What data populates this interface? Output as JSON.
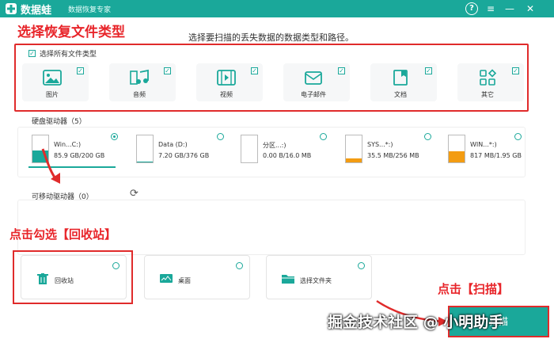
{
  "titlebar": {
    "app_name": "数据蛙",
    "app_subtitle": "数据恢复专家",
    "help_icon": "?",
    "menu_icon": "≡",
    "min_icon": "—",
    "close_icon": "✕"
  },
  "annotations": {
    "heading": "选择恢复文件类型",
    "recycle": "点击勾选【回收站】",
    "scan": "点击【扫描】"
  },
  "instruction": "选择要扫描的丢失数据的数据类型和路径。",
  "select_all": "选择所有文件类型",
  "file_types": [
    {
      "label": "图片",
      "icon": "image-icon",
      "checked": true
    },
    {
      "label": "音频",
      "icon": "audio-icon",
      "checked": true
    },
    {
      "label": "视频",
      "icon": "video-icon",
      "checked": true
    },
    {
      "label": "电子邮件",
      "icon": "email-icon",
      "checked": true
    },
    {
      "label": "文档",
      "icon": "document-icon",
      "checked": true
    },
    {
      "label": "其它",
      "icon": "other-icon",
      "checked": true
    }
  ],
  "hard_drives": {
    "label": "硬盘驱动器（5）",
    "items": [
      {
        "name": "Win...C:)",
        "size": "85.9 GB/200 GB",
        "used_fraction": 0.43,
        "color": "#1aa89a",
        "selected": true
      },
      {
        "name": "Data (D:)",
        "size": "7.20 GB/376 GB",
        "used_fraction": 0.02,
        "color": "#1aa89a",
        "selected": false
      },
      {
        "name": "分区...:)",
        "size": "0.00  B/16.0 MB",
        "used_fraction": 0.0,
        "color": "#f39c12",
        "selected": false
      },
      {
        "name": "SYS...*:)",
        "size": "35.5 MB/256 MB",
        "used_fraction": 0.14,
        "color": "#f39c12",
        "selected": false
      },
      {
        "name": "WIN...*:)",
        "size": "817 MB/1.95 GB",
        "used_fraction": 0.42,
        "color": "#f39c12",
        "selected": false
      }
    ]
  },
  "removable": {
    "label": "可移动驱动器（0）",
    "refresh_icon": "⟳"
  },
  "locations": [
    {
      "label": "回收站",
      "icon": "trash-icon"
    },
    {
      "label": "桌面",
      "icon": "desktop-icon"
    },
    {
      "label": "选择文件夹",
      "icon": "folder-icon"
    }
  ],
  "scan_button": "扫描",
  "watermark": "掘金技术社区 @ 小明助手",
  "colors": {
    "accent": "#1aa89a",
    "annotation": "#e8252a",
    "warning": "#f39c12"
  }
}
